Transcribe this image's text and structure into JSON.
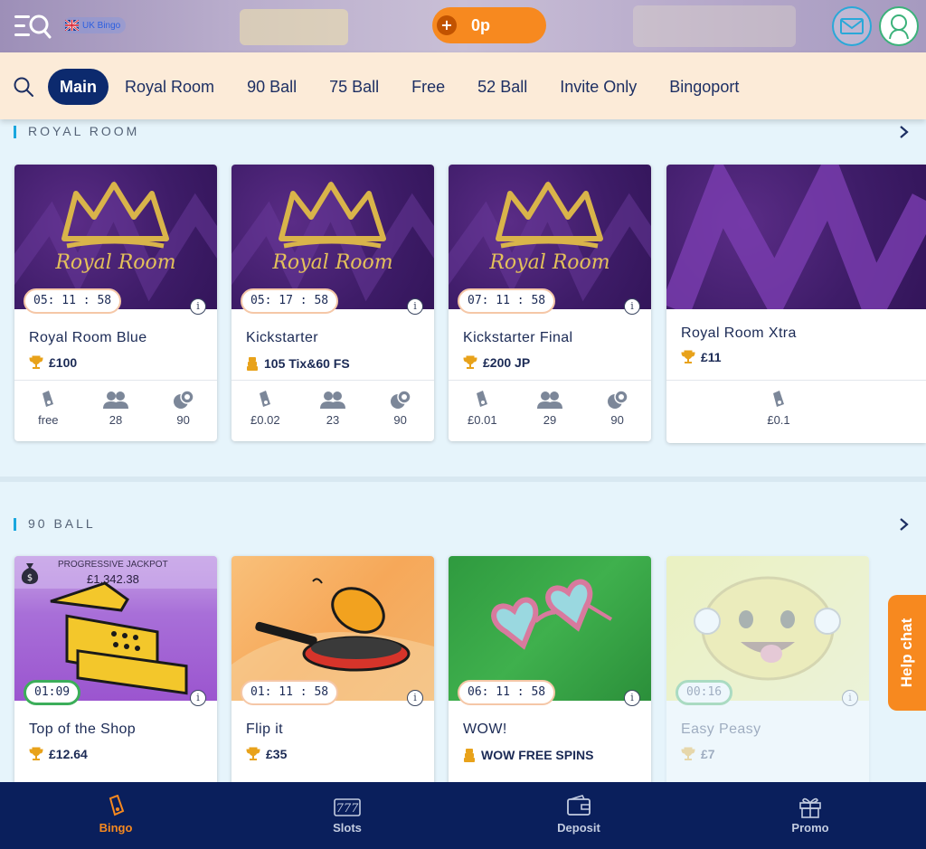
{
  "header": {
    "language_label": "UK Bingo",
    "balance": "0p",
    "colors": {
      "balance_bg": "#f7891f",
      "nav_active": "#0c2a6e"
    }
  },
  "nav": {
    "tabs": [
      {
        "label": "Main",
        "active": true
      },
      {
        "label": "Royal Room"
      },
      {
        "label": "90 Ball"
      },
      {
        "label": "75 Ball"
      },
      {
        "label": "Free"
      },
      {
        "label": "52 Ball"
      },
      {
        "label": "Invite Only"
      },
      {
        "label": "Bingoport"
      }
    ]
  },
  "sections": [
    {
      "title": "ROYAL ROOM",
      "cards": [
        {
          "timer": "05: 11 : 58",
          "logo_text": "Royal Room",
          "name": "Royal Room Blue",
          "prize": "£100",
          "prize_icon": "trophy-icon",
          "ticket": "free",
          "players": "28",
          "balls": "90"
        },
        {
          "timer": "05: 17 : 58",
          "logo_text": "Royal Room",
          "name": "Kickstarter",
          "prize": "105 Tix&60 FS",
          "prize_icon": "coins-icon",
          "ticket": "£0.02",
          "players": "23",
          "balls": "90"
        },
        {
          "timer": "07: 11 : 58",
          "logo_text": "Royal Room",
          "name": "Kickstarter Final",
          "prize": "£200 JP",
          "prize_icon": "trophy-icon",
          "ticket": "£0.01",
          "players": "29",
          "balls": "90"
        },
        {
          "name": "Royal Room Xtra",
          "prize": "£11",
          "prize_icon": "trophy-icon",
          "ticket": "£0.1"
        }
      ]
    },
    {
      "title": "90 BALL",
      "cards": [
        {
          "jackpot_label": "PROGRESSIVE JACKPOT",
          "jackpot_value": "£1,342.38",
          "timer": "01:09",
          "name": "Top of the Shop",
          "prize": "£12.64",
          "prize_icon": "trophy-icon"
        },
        {
          "timer": "01: 11 : 58",
          "name": "Flip it",
          "prize": "£35",
          "prize_icon": "trophy-icon"
        },
        {
          "timer": "06: 11 : 58",
          "name": "WOW!",
          "prize": "WOW FREE SPINS",
          "prize_icon": "coins-icon"
        },
        {
          "timer": "00:16",
          "name": "Easy Peasy",
          "prize": "£7",
          "prize_icon": "trophy-icon"
        }
      ]
    }
  ],
  "help_chat": "Help chat",
  "bottom_nav": [
    {
      "label": "Bingo",
      "active": true
    },
    {
      "label": "Slots"
    },
    {
      "label": "Deposit"
    },
    {
      "label": "Promo"
    }
  ]
}
